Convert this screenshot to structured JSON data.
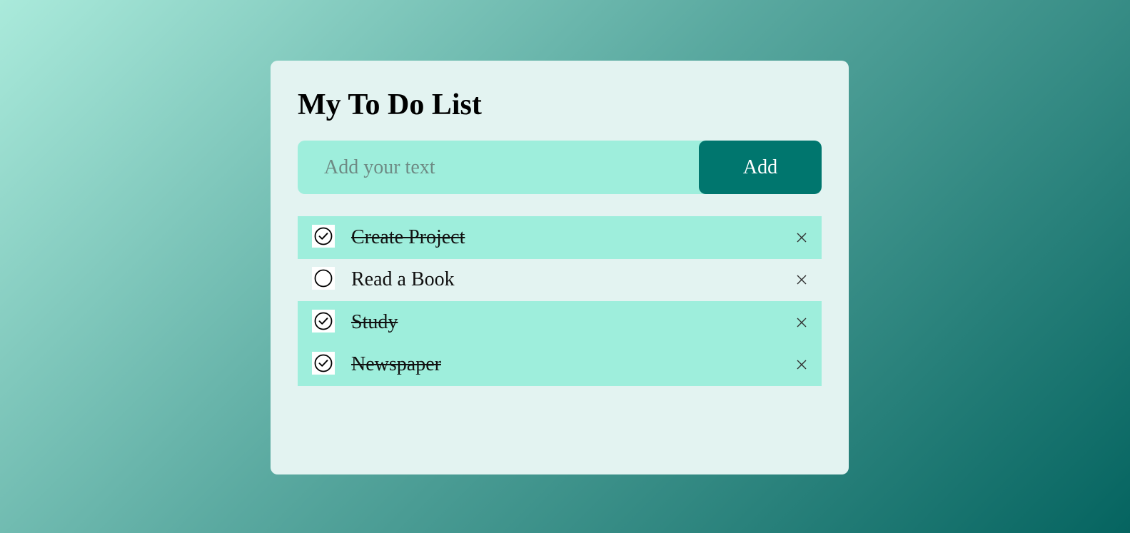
{
  "app": {
    "title": "My To Do List"
  },
  "input": {
    "placeholder": "Add your text",
    "value": ""
  },
  "add_button": {
    "label": "Add"
  },
  "todos": [
    {
      "text": "Create Project",
      "checked": true
    },
    {
      "text": "Read a Book",
      "checked": false
    },
    {
      "text": "Study",
      "checked": true
    },
    {
      "text": "Newspaper",
      "checked": true
    }
  ],
  "icons": {
    "checked": "check-circle-icon",
    "unchecked": "empty-circle-icon",
    "delete": "close-icon"
  },
  "colors": {
    "gradient_start": "#aaeadb",
    "gradient_end": "#056460",
    "card_background": "#e3f3f1",
    "accent": "#00766e",
    "checked_row": "#9eeedc",
    "input_background": "#9eeedc"
  }
}
